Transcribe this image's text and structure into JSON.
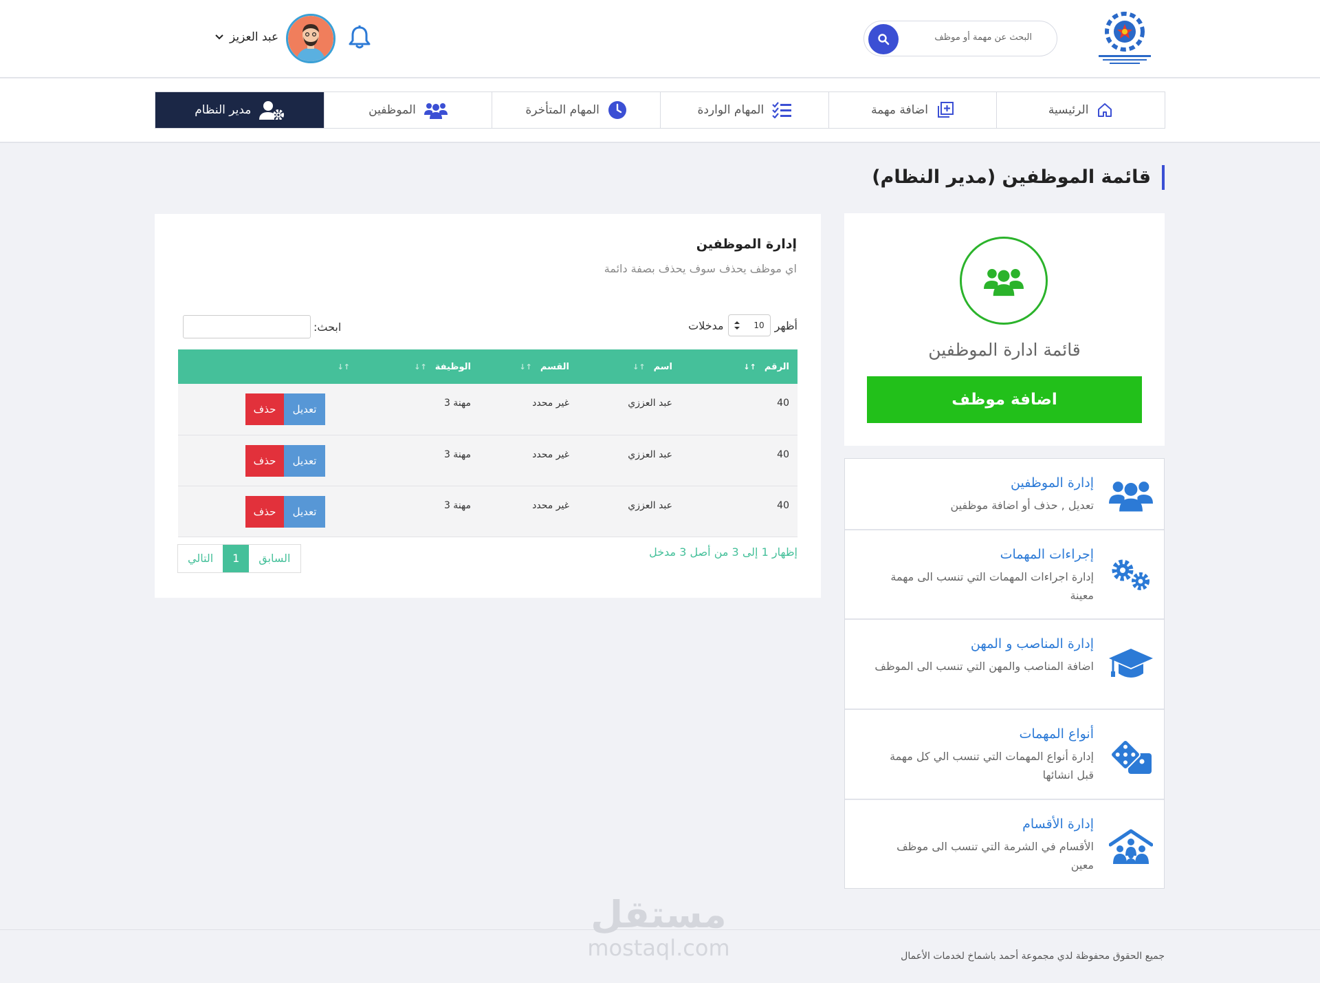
{
  "header": {
    "search_placeholder": "البحث عن مهمة أو موظف",
    "username": "عبد العزيز"
  },
  "nav": {
    "items": [
      {
        "label": "الرئيسية"
      },
      {
        "label": "اضافة مهمة"
      },
      {
        "label": "المهام الواردة"
      },
      {
        "label": "المهام المتأخرة"
      },
      {
        "label": "الموظفين"
      },
      {
        "label": "مدير النظام"
      }
    ]
  },
  "page": {
    "title": "قائمة الموظفين (مدير النظام)"
  },
  "side_card": {
    "title": "قائمة ادارة الموظفين",
    "add_button": "اضافة موظف"
  },
  "menu": {
    "items": [
      {
        "title": "إدارة الموظفين",
        "desc": "تعديل , حذف أو اضافة موظفين"
      },
      {
        "title": "إجراءات المهمات",
        "desc": "إدارة اجراءات المهمات التي تنسب الى مهمة معينة"
      },
      {
        "title": "إدارة المناصب و المهن",
        "desc": "اضافة المناصب والمهن التي تنسب الى الموظف"
      },
      {
        "title": "أنواع المهمات",
        "desc": "إدارة أنواع المهمات التي تنسب الي كل مهمة قبل انشائها"
      },
      {
        "title": "إدارة الأقسام",
        "desc": "الأقسام في الشرمة التي تنسب الى موظف معين"
      }
    ]
  },
  "table_card": {
    "heading": "إدارة الموظفين",
    "subheading": "اي موظف يحذف سوف يحذف بصفة دائمة",
    "length_show": "أظهر",
    "length_value": "10",
    "length_entries": "مدخلات",
    "search_label": "ابحث:",
    "columns": [
      "الرقم",
      "اسم",
      "القسم",
      "الوظيفة"
    ],
    "rows": [
      {
        "id": "40",
        "name": "عبد العززي",
        "dept": "غير محدد",
        "job": "مهنة 3"
      },
      {
        "id": "40",
        "name": "عبد العززي",
        "dept": "غير محدد",
        "job": "مهنة 3"
      },
      {
        "id": "40",
        "name": "عبد العززي",
        "dept": "غير محدد",
        "job": "مهنة 3"
      }
    ],
    "edit_label": "تعديل",
    "delete_label": "حذف",
    "info": "إظهار 1 إلى 3 من أصل 3 مدخل",
    "pager": {
      "prev": "السابق",
      "current": "1",
      "next": "التالي"
    }
  },
  "footer": {
    "copyright": "جميع الحقوق محفوظة لدي مجموعة أحمد باشماخ لخدمات الأعمال",
    "watermark_ar": "مستقل",
    "watermark_en": "mostaql.com"
  },
  "colors": {
    "primary": "#3b4fd4",
    "nav_active": "#1b2746",
    "green": "#22c01a",
    "teal": "#45c09a",
    "link_blue": "#2c7ad6",
    "edit_blue": "#5797d6",
    "delete_red": "#e2313b"
  }
}
